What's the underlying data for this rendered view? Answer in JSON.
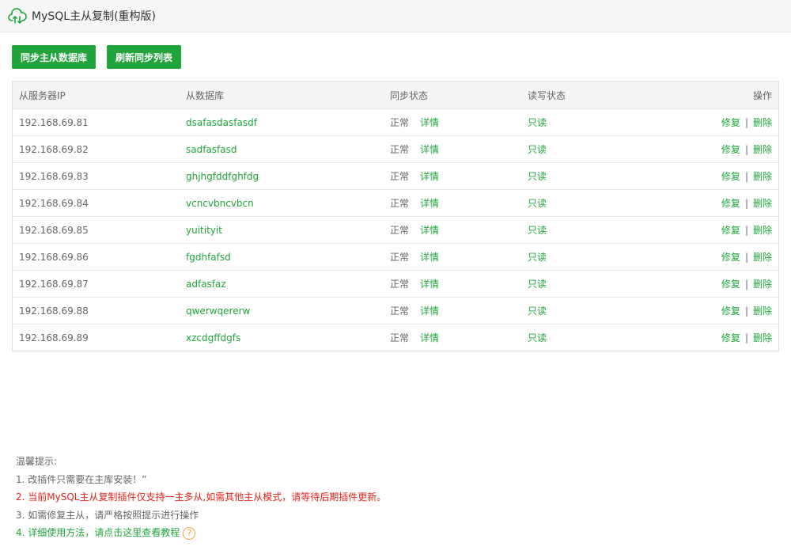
{
  "window": {
    "title": "MySQL主从复制(重构版)",
    "icon": "cloud-sync-icon"
  },
  "toolbar": {
    "sync_db_label": "同步主从数据库",
    "refresh_label": "刷新同步列表"
  },
  "table": {
    "headers": {
      "ip": "从服务器IP",
      "db": "从数据库",
      "sync": "同步状态",
      "rw": "读写状态",
      "op": "操作"
    },
    "rows": [
      {
        "ip": "192.168.69.81",
        "db": "dsafasdasfasdf",
        "sync": "正常",
        "detail": "详情",
        "rw": "只读",
        "repair": "修复",
        "sep": "|",
        "delete": "删除"
      },
      {
        "ip": "192.168.69.82",
        "db": "sadfasfasd",
        "sync": "正常",
        "detail": "详情",
        "rw": "只读",
        "repair": "修复",
        "sep": "|",
        "delete": "删除"
      },
      {
        "ip": "192.168.69.83",
        "db": "ghjhgfddfghfdg",
        "sync": "正常",
        "detail": "详情",
        "rw": "只读",
        "repair": "修复",
        "sep": "|",
        "delete": "删除"
      },
      {
        "ip": "192.168.69.84",
        "db": "vcncvbncvbcn",
        "sync": "正常",
        "detail": "详情",
        "rw": "只读",
        "repair": "修复",
        "sep": "|",
        "delete": "删除"
      },
      {
        "ip": "192.168.69.85",
        "db": "yuitityit",
        "sync": "正常",
        "detail": "详情",
        "rw": "只读",
        "repair": "修复",
        "sep": "|",
        "delete": "删除"
      },
      {
        "ip": "192.168.69.86",
        "db": "fgdhfafsd",
        "sync": "正常",
        "detail": "详情",
        "rw": "只读",
        "repair": "修复",
        "sep": "|",
        "delete": "删除"
      },
      {
        "ip": "192.168.69.87",
        "db": "adfasfaz",
        "sync": "正常",
        "detail": "详情",
        "rw": "只读",
        "repair": "修复",
        "sep": "|",
        "delete": "删除"
      },
      {
        "ip": "192.168.69.88",
        "db": "qwerwqererw",
        "sync": "正常",
        "detail": "详情",
        "rw": "只读",
        "repair": "修复",
        "sep": "|",
        "delete": "删除"
      },
      {
        "ip": "192.168.69.89",
        "db": "xzcdgffdgfs",
        "sync": "正常",
        "detail": "详情",
        "rw": "只读",
        "repair": "修复",
        "sep": "|",
        "delete": "删除"
      }
    ]
  },
  "tips": {
    "heading": "温馨提示:",
    "items": [
      "1. 改插件只需要在主库安装！”",
      "2. 当前MySQL主从复制插件仅支持一主多从,如需其他主从模式，请等待后期插件更新。",
      "3. 如需修复主从，请严格按照提示进行操作",
      "4. 详细使用方法，请点击这里查看教程"
    ],
    "help_icon": "question-circle-icon",
    "help_glyph": "?"
  },
  "colors": {
    "accent": "#20a53a",
    "warning": "#e1251b",
    "help": "#f0a23a"
  }
}
